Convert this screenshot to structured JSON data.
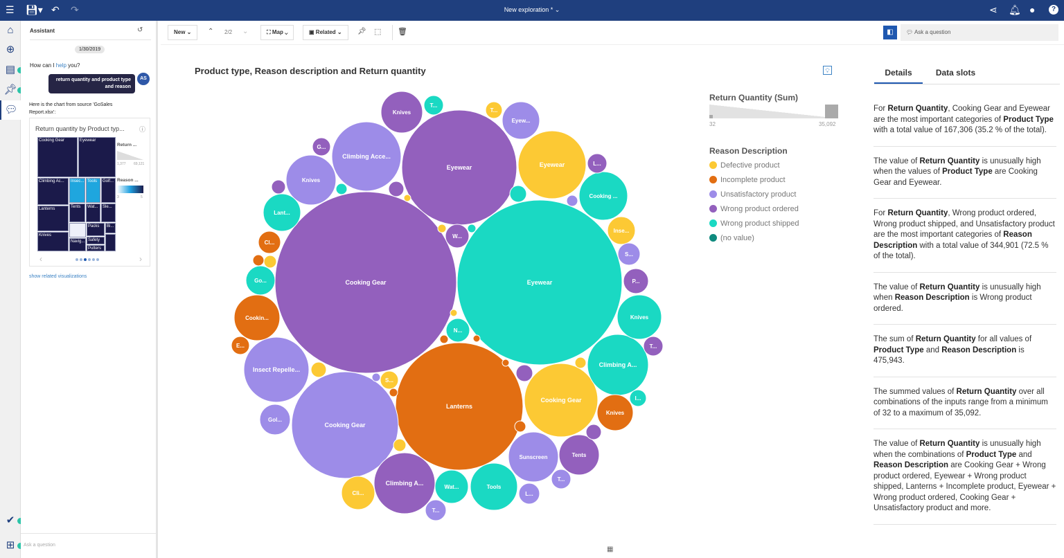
{
  "topbar": {
    "title": "New exploration *",
    "icons": [
      "toc-icon",
      "save-icon",
      "undo-icon",
      "redo-icon",
      "share-icon",
      "bell-icon",
      "user-icon",
      "help-icon"
    ]
  },
  "rail": {
    "icons": [
      "home-icon",
      "explore-icon",
      "data-icon",
      "pin-icon",
      "assistant-icon",
      "checkmark-icon",
      "add-icon"
    ]
  },
  "assistant": {
    "title": "Assistant",
    "date": "1/30/2019",
    "greeting_pre": "How can I ",
    "greeting_link": "help",
    "greeting_post": " you?",
    "user_message": "return quantity and product type and reason",
    "avatar": "AS",
    "reply": "Here is the chart from source 'GoSales Report.xlsx':",
    "card_title": "Return quantity by Product typ...",
    "treemap": [
      "Cooking Gear",
      "Eyewear",
      "Climbing Ac...",
      "Insec...",
      "Tools",
      "Golf...",
      "Lanterns",
      "Tents",
      "Wat...",
      "Sle...",
      "Knives",
      "",
      "Packs",
      "Bi...",
      "Navig...",
      "Safety",
      "Putters",
      ""
    ],
    "legend_size_title": "Return ...",
    "legend_size_min": "1,377",
    "legend_size_max": "69,121",
    "legend_color_title": "Reason ...",
    "legend_color_min": "3",
    "legend_color_max": "5",
    "pager_dots": 6,
    "pager_active": 3,
    "related_link": "show related visualizations",
    "ask_placeholder": "Ask a question"
  },
  "toolbar": {
    "new": "New",
    "page": "2/2",
    "map": "Map",
    "related": "Related",
    "ask_placeholder": "Ask a question"
  },
  "colors": {
    "Defective product": "#fcc934",
    "Incomplete product": "#e26e12",
    "Unsatisfactory product": "#9d8ce8",
    "Wrong product ordered": "#9360bd",
    "Wrong product shipped": "#1ad9c3",
    "(no value)": "#0f8a7e",
    "accent": "#1f3f7e"
  },
  "chart_data": {
    "type": "bubble",
    "title": "Product type, Reason description and Return quantity",
    "size_legend": {
      "title": "Return Quantity (Sum)",
      "min": "32",
      "max": "35,092"
    },
    "color_legend": {
      "title": "Reason Description",
      "items": [
        "Defective product",
        "Incomplete product",
        "Unsatisfactory product",
        "Wrong product ordered",
        "Wrong product shipped",
        "(no value)"
      ]
    },
    "bubbles": [
      {
        "label": "Cooking Gear",
        "reason": "Wrong product ordered",
        "value": 35092
      },
      {
        "label": "Eyewear",
        "reason": "Wrong product shipped",
        "value": 28958
      },
      {
        "label": "Eyewear",
        "reason": "Wrong product ordered",
        "value": 14087
      },
      {
        "label": "Lanterns",
        "reason": "Incomplete product",
        "value": 17307
      },
      {
        "label": "Cooking Gear",
        "reason": "Unsatisfactory product",
        "value": 12124
      },
      {
        "label": "Eyewear",
        "reason": "Defective product",
        "value": 4910
      },
      {
        "label": "Cooking Gear",
        "reason": "Defective product",
        "value": 5744
      },
      {
        "label": "Climbing Acce...",
        "reason": "Unsatisfactory product",
        "value": 5112
      },
      {
        "label": "Insect Repelle...",
        "reason": "Unsatisfactory product",
        "value": 4517
      },
      {
        "label": "Climbing A...",
        "reason": "Wrong product ordered",
        "value": 3959
      },
      {
        "label": "Climbing A...",
        "reason": "Wrong product shipped",
        "value": 3959
      },
      {
        "label": "Cooking ...",
        "reason": "Wrong product shipped",
        "value": 2505
      },
      {
        "label": "Knives",
        "reason": "Unsatisfactory product",
        "value": 2650
      },
      {
        "label": "Knives",
        "reason": "Wrong product shipped",
        "value": 2093
      },
      {
        "label": "Cookin...",
        "reason": "Incomplete product",
        "value": 2225
      },
      {
        "label": "Sunscreen",
        "reason": "Unsatisfactory product",
        "value": 2650
      },
      {
        "label": "Tents",
        "reason": "Wrong product ordered",
        "value": 1720
      },
      {
        "label": "Tools",
        "reason": "Wrong product shipped",
        "value": 2364
      },
      {
        "label": "Knives",
        "reason": "Wrong product ordered",
        "value": 1840
      },
      {
        "label": "Lant...",
        "reason": "Wrong product shipped",
        "value": 1491
      },
      {
        "label": "Eyew...",
        "reason": "Unsatisfactory product",
        "value": 1491
      },
      {
        "label": "Knives",
        "reason": "Incomplete product",
        "value": 1382
      },
      {
        "label": "Wat...",
        "reason": "Wrong product shipped",
        "value": 1178
      },
      {
        "label": "Cli...",
        "reason": "Defective product",
        "value": 1178
      },
      {
        "label": "Gol...",
        "reason": "Unsatisfactory product",
        "value": 993
      },
      {
        "label": "Go...",
        "reason": "Wrong product shipped",
        "value": 902
      },
      {
        "label": "Inse...",
        "reason": "Defective product",
        "value": 818
      },
      {
        "label": "P...",
        "reason": "Wrong product ordered",
        "value": 663
      },
      {
        "label": "S...",
        "reason": "Unsatisfactory product",
        "value": 524
      },
      {
        "label": "L...",
        "reason": "Wrong product ordered",
        "value": 401
      },
      {
        "label": "T...",
        "reason": "Wrong product ordered",
        "value": 401
      },
      {
        "label": "T...",
        "reason": "Wrong product shipped",
        "value": 401
      },
      {
        "label": "Cl...",
        "reason": "Incomplete product",
        "value": 524
      },
      {
        "label": "E...",
        "reason": "Incomplete product",
        "value": 345
      },
      {
        "label": "W...",
        "reason": "Wrong product ordered",
        "value": 591
      },
      {
        "label": "N...",
        "reason": "Wrong product shipped",
        "value": 591
      },
      {
        "label": "S...",
        "reason": "Defective product",
        "value": 345
      },
      {
        "label": "G...",
        "reason": "Wrong product ordered",
        "value": 345
      },
      {
        "label": "T...",
        "reason": "Unsatisfactory product",
        "value": 401
      },
      {
        "label": "L...",
        "reason": "Unsatisfactory product",
        "value": 460
      },
      {
        "label": "T...",
        "reason": "Unsatisfactory product",
        "value": 460
      },
      {
        "label": "I...",
        "reason": "Wrong product shipped",
        "value": 294
      },
      {
        "label": "T...",
        "reason": "Defective product",
        "value": 294
      },
      {
        "label": "",
        "reason": "Wrong product ordered",
        "value": 204
      },
      {
        "label": "",
        "reason": "Wrong product shipped",
        "value": 131
      },
      {
        "label": "",
        "reason": "Wrong product ordered",
        "value": 247
      },
      {
        "label": "",
        "reason": "Wrong product shipped",
        "value": 294
      },
      {
        "label": "",
        "reason": "Unsatisfactory product",
        "value": 131
      },
      {
        "label": "",
        "reason": "Incomplete product",
        "value": 131
      },
      {
        "label": "",
        "reason": "Defective product",
        "value": 166
      },
      {
        "label": "",
        "reason": "Defective product",
        "value": 247
      },
      {
        "label": "",
        "reason": "Unsatisfactory product",
        "value": 74
      },
      {
        "label": "",
        "reason": "Wrong product ordered",
        "value": 294
      },
      {
        "label": "",
        "reason": "Defective product",
        "value": 131
      },
      {
        "label": "",
        "reason": "Incomplete product",
        "value": 131
      },
      {
        "label": "",
        "reason": "Wrong product ordered",
        "value": 247
      },
      {
        "label": "",
        "reason": "Defective product",
        "value": 166
      },
      {
        "label": "",
        "reason": "Incomplete product",
        "value": 74
      },
      {
        "label": "",
        "reason": "Defective product",
        "value": 51
      },
      {
        "label": "",
        "reason": "Defective product",
        "value": 74
      },
      {
        "label": "",
        "reason": "Wrong product shipped",
        "value": 74
      },
      {
        "label": "",
        "reason": "Defective product",
        "value": 51
      },
      {
        "label": "",
        "reason": "Incomplete product",
        "value": 51
      },
      {
        "label": "",
        "reason": "Incomplete product",
        "value": 74
      },
      {
        "label": "",
        "reason": "Incomplete product",
        "value": 51
      }
    ]
  },
  "details": {
    "tabs": [
      "Details",
      "Data slots"
    ],
    "active_tab": 0,
    "insights": [
      [
        {
          "t": "For "
        },
        {
          "t": "Return Quantity",
          "b": true
        },
        {
          "t": ", Cooking Gear and Eyewear are the most important categories of "
        },
        {
          "t": "Product Type",
          "b": true
        },
        {
          "t": " with a total value of 167,306 (35.2 % of the total)."
        }
      ],
      [
        {
          "t": "The value of "
        },
        {
          "t": "Return Quantity",
          "b": true
        },
        {
          "t": " is unusually high when the values of "
        },
        {
          "t": "Product Type",
          "b": true
        },
        {
          "t": " are Cooking Gear and Eyewear."
        }
      ],
      [
        {
          "t": "For "
        },
        {
          "t": "Return Quantity",
          "b": true
        },
        {
          "t": ", Wrong product ordered, Wrong product shipped, and Unsatisfactory product are the most important categories of "
        },
        {
          "t": "Reason Description",
          "b": true
        },
        {
          "t": " with a total value of 344,901 (72.5 % of the total)."
        }
      ],
      [
        {
          "t": "The value of "
        },
        {
          "t": "Return Quantity",
          "b": true
        },
        {
          "t": " is unusually high when "
        },
        {
          "t": "Reason Description",
          "b": true
        },
        {
          "t": " is Wrong product ordered."
        }
      ],
      [
        {
          "t": "The sum of "
        },
        {
          "t": "Return Quantity",
          "b": true
        },
        {
          "t": " for all values of "
        },
        {
          "t": "Product Type",
          "b": true
        },
        {
          "t": " and "
        },
        {
          "t": "Reason Description",
          "b": true
        },
        {
          "t": " is 475,943."
        }
      ],
      [
        {
          "t": "The summed values of "
        },
        {
          "t": "Return Quantity",
          "b": true
        },
        {
          "t": " over all combinations of the inputs range from a minimum of 32 to a maximum of 35,092."
        }
      ],
      [
        {
          "t": "The value of "
        },
        {
          "t": "Return Quantity",
          "b": true
        },
        {
          "t": " is unusually high when the combinations of "
        },
        {
          "t": "Product Type",
          "b": true
        },
        {
          "t": " and "
        },
        {
          "t": "Reason Description",
          "b": true
        },
        {
          "t": " are Cooking Gear + Wrong product ordered, Eyewear + Wrong product shipped, Lanterns + Incomplete product, Eyewear + Wrong product ordered, Cooking Gear + Unsatisfactory product and more."
        }
      ]
    ]
  }
}
